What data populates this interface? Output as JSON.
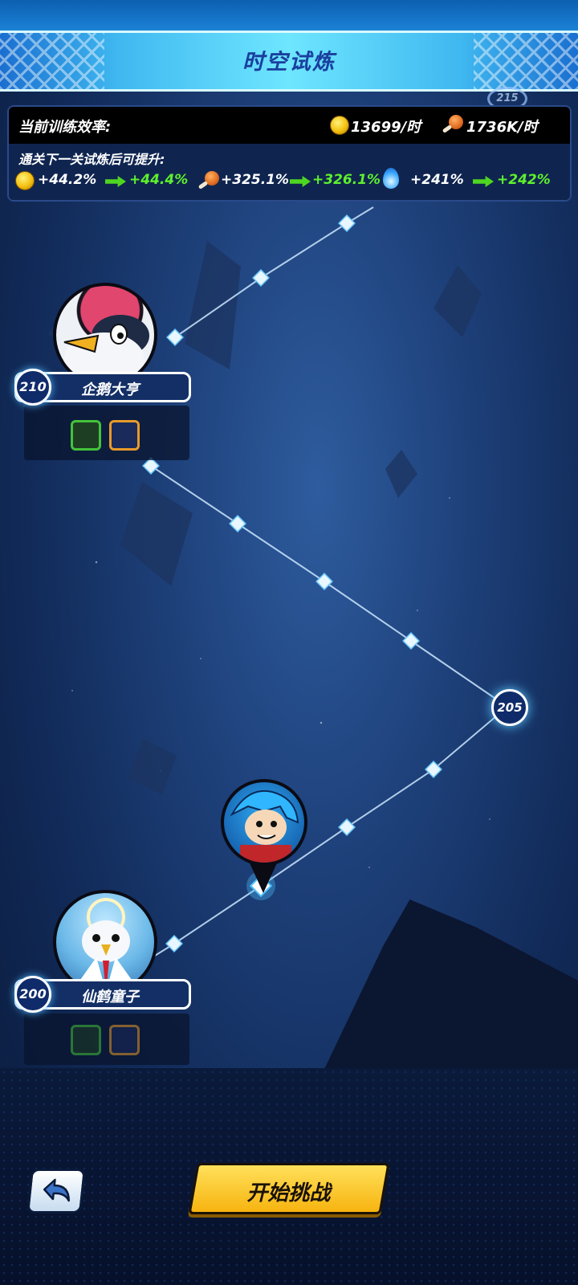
{
  "header": {
    "title": "时空试炼"
  },
  "info_panel": {
    "current_label": "当前训练效率:",
    "gold_rate": "13699/时",
    "meat_rate": "1736K/时",
    "next_label": "通关下一关试炼后可提升:",
    "gold_from": "+44.2%",
    "gold_to": "+44.4%",
    "meat_from": "+325.1%",
    "meat_to": "+326.1%",
    "flame_from": "+241%",
    "flame_to": "+242%"
  },
  "stages": {
    "upper": {
      "level": "210",
      "name": "企鹅大亨"
    },
    "lower": {
      "level": "200",
      "name": "仙鹤童子"
    },
    "node_205": "205",
    "node_215": "215"
  },
  "buttons": {
    "start": "开始挑战"
  },
  "icons": {
    "gold": "gold-coin-icon",
    "meat": "meat-icon",
    "flame": "blue-flame-icon",
    "reward_1": "green-blade-icon",
    "reward_2": "blue-star-crystal-icon",
    "back": "back-arrow-icon"
  },
  "colors": {
    "increase_green": "#5ef02c",
    "start_yellow": "#f7b410",
    "header_cyan": "#6ee6ff"
  }
}
